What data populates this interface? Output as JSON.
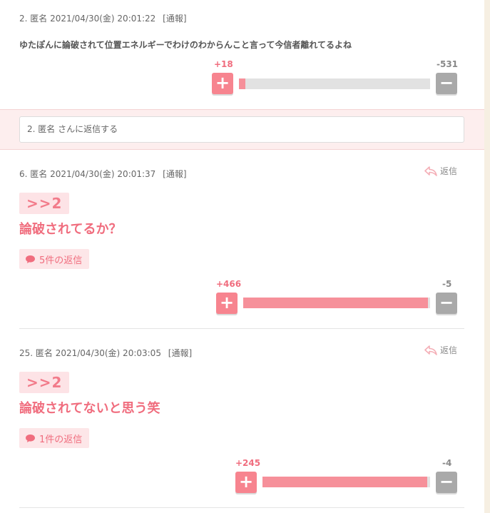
{
  "comments": [
    {
      "meta": "2. 匿名 2021/04/30(金) 20:01:22",
      "report": "[通報]",
      "body": "ゆたぽんに論破されて位置エネルギーでわけのわからんこと言って今信者離れてるよね",
      "plus": "+18",
      "minus": "-531",
      "plus_share": 0.033
    },
    {
      "meta": "6. 匿名 2021/04/30(金) 20:01:37",
      "report": "[通報]",
      "reply_label": "返信",
      "anchor": ">>2",
      "body": "論破されてるか？",
      "reply_count": "5件の返信",
      "plus": "+466",
      "minus": "-5",
      "plus_share": 0.989
    },
    {
      "meta": "25. 匿名 2021/04/30(金) 20:03:05",
      "report": "[通報]",
      "reply_label": "返信",
      "anchor": ">>2",
      "body": "論破されてないと思う笑",
      "reply_count": "1件の返信",
      "plus": "+245",
      "minus": "-4",
      "plus_share": 0.984
    }
  ],
  "reply_form": {
    "placeholder": "2. 匿名 さんに返信する"
  },
  "vote_buttons": {
    "plus_symbol": "+",
    "minus_symbol": "−"
  },
  "icons": {
    "reply": "reply-arrow-icon",
    "speech": "speech-bubble-icon"
  },
  "colors": {
    "accent": "#f06d7e",
    "plus_button": "#f7848f",
    "minus_button": "#a9a9a9",
    "bar_fill": "#f6909a",
    "bar_track": "#e2e2e2",
    "panel_bg": "#fdeeee"
  }
}
